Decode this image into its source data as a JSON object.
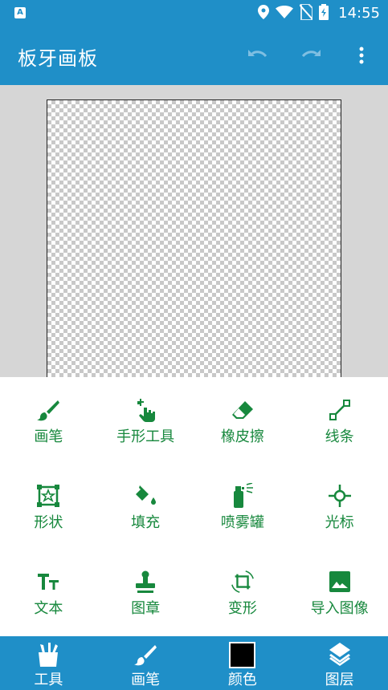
{
  "status_bar": {
    "time": "14:55",
    "left_icon_letter": "A"
  },
  "app_bar": {
    "title": "板牙画板"
  },
  "tools": [
    {
      "label": "画笔",
      "icon": "brush-icon"
    },
    {
      "label": "手形工具",
      "icon": "hand-tool-icon"
    },
    {
      "label": "橡皮擦",
      "icon": "eraser-icon"
    },
    {
      "label": "线条",
      "icon": "line-icon"
    },
    {
      "label": "形状",
      "icon": "shape-icon"
    },
    {
      "label": "填充",
      "icon": "fill-bucket-icon"
    },
    {
      "label": "喷雾罐",
      "icon": "spray-can-icon"
    },
    {
      "label": "光标",
      "icon": "cursor-icon"
    },
    {
      "label": "文本",
      "icon": "text-icon"
    },
    {
      "label": "图章",
      "icon": "stamp-icon"
    },
    {
      "label": "变形",
      "icon": "transform-icon"
    },
    {
      "label": "导入图像",
      "icon": "import-image-icon"
    }
  ],
  "bottom_nav": [
    {
      "label": "工具",
      "icon": "tools-icon"
    },
    {
      "label": "画笔",
      "icon": "brush-icon"
    },
    {
      "label": "颜色",
      "icon": "color-swatch",
      "color": "#000000"
    },
    {
      "label": "图层",
      "icon": "layers-icon"
    }
  ],
  "colors": {
    "primary": "#1f8fc8",
    "tool_green": "#17883d",
    "panel_bg": "#ffffff"
  }
}
